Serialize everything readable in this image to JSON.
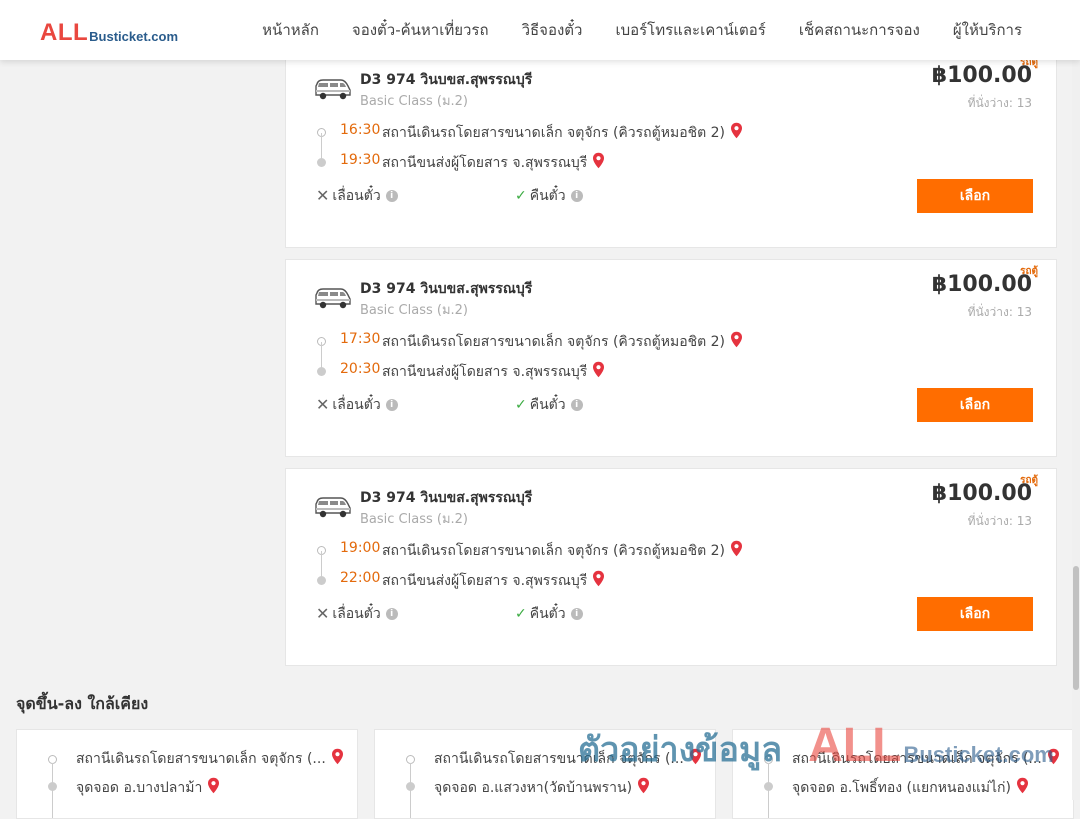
{
  "header": {
    "logo_all": "ALL",
    "logo_rest": "Busticket.com",
    "nav": [
      "หน้าหลัก",
      "จองตั๋ว-ค้นหาเที่ยวรถ",
      "วิธีจองตั๋ว",
      "เบอร์โทรและเคาน์เตอร์",
      "เช็คสถานะการจอง",
      "ผู้ให้บริการ"
    ]
  },
  "trips": [
    {
      "badge": "รถตู้",
      "name": "D3 974 วินบขส.สุพรรณบุรี",
      "class": "Basic Class (ม.2)",
      "price": "฿100.00",
      "seats": "ที่นั่งว่าง: 13",
      "depart_time": "16:30",
      "depart_stop": "สถานีเดินรถโดยสารขนาดเล็ก จตุจักร (คิวรถตู้หมอชิต 2)",
      "arrive_time": "19:30",
      "arrive_stop": "สถานีขนส่งผู้โดยสาร จ.สุพรรณบุรี",
      "reschedule": "เลื่อนตั๋ว",
      "refund": "คืนตั๋ว",
      "select": "เลือก"
    },
    {
      "badge": "รถตู้",
      "name": "D3 974 วินบขส.สุพรรณบุรี",
      "class": "Basic Class (ม.2)",
      "price": "฿100.00",
      "seats": "ที่นั่งว่าง: 13",
      "depart_time": "17:30",
      "depart_stop": "สถานีเดินรถโดยสารขนาดเล็ก จตุจักร (คิวรถตู้หมอชิต 2)",
      "arrive_time": "20:30",
      "arrive_stop": "สถานีขนส่งผู้โดยสาร จ.สุพรรณบุรี",
      "reschedule": "เลื่อนตั๋ว",
      "refund": "คืนตั๋ว",
      "select": "เลือก"
    },
    {
      "badge": "รถตู้",
      "name": "D3 974 วินบขส.สุพรรณบุรี",
      "class": "Basic Class (ม.2)",
      "price": "฿100.00",
      "seats": "ที่นั่งว่าง: 13",
      "depart_time": "19:00",
      "depart_stop": "สถานีเดินรถโดยสารขนาดเล็ก จตุจักร (คิวรถตู้หมอชิต 2)",
      "arrive_time": "22:00",
      "arrive_stop": "สถานีขนส่งผู้โดยสาร จ.สุพรรณบุรี",
      "reschedule": "เลื่อนตั๋ว",
      "refund": "คืนตั๋ว",
      "select": "เลือก"
    }
  ],
  "nearby": {
    "title": "จุดขึ้น-ลง ใกล้เคียง",
    "items": [
      {
        "from": "สถานีเดินรถโดยสารขนาดเล็ก จตุจักร (...",
        "to": "จุดจอด อ.บางปลาม้า"
      },
      {
        "from": "สถานีเดินรถโดยสารขนาดเล็ก จตุจักร (...",
        "to": "จุดจอด อ.แสวงหา(วัดบ้านพราน)"
      },
      {
        "from": "สถานีเดินรถโดยสารขนาดเล็ก จตุจักร (...",
        "to": "จุดจอด อ.โพธิ์ทอง (แยกหนองแม่ไก่)"
      }
    ]
  },
  "watermark": {
    "thai": "ตัวอย่างข้อมูล",
    "all": "ALL",
    "rest": "Busticket.com"
  },
  "icons": {
    "van": "van-icon",
    "pin": "location-pin-icon",
    "close": "x-icon",
    "check": "check-icon",
    "info": "info-icon"
  },
  "colors": {
    "accent": "#ff6d00",
    "time": "#e36a0c",
    "pin": "#e5333f",
    "check": "#3bab42",
    "logo_red": "#e9473f",
    "logo_blue": "#2a5c8c"
  }
}
